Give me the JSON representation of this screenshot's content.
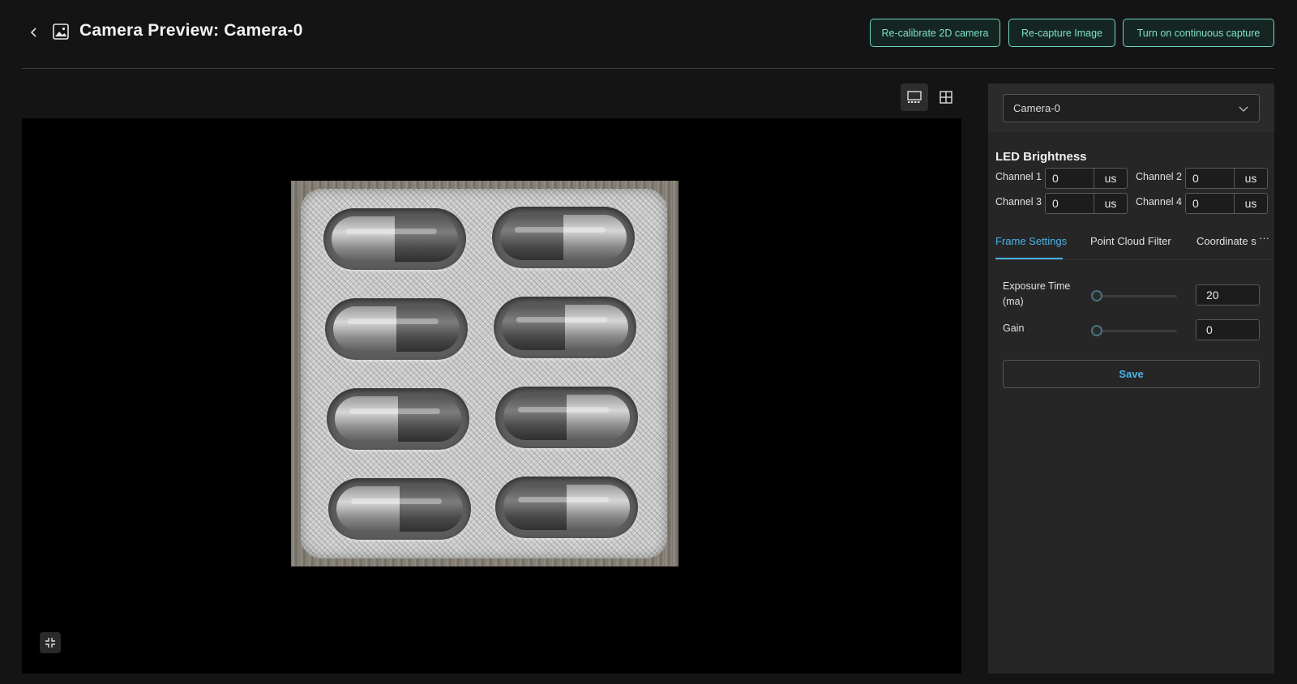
{
  "header": {
    "title": "Camera Preview: Camera-0",
    "buttons": {
      "recalibrate": "Re-calibrate 2D camera",
      "recapture": "Re-capture Image",
      "continuous": "Turn on continuous capture"
    }
  },
  "colors": {
    "accent_teal": "#7fe0cc",
    "accent_blue": "#4cb3e8",
    "background": "#141414",
    "panel": "#262626"
  },
  "icons": {
    "back": "chevron-left-icon",
    "title": "image-icon",
    "single_view": "single-view-icon",
    "grid_view": "grid-view-icon",
    "fit": "collapse-icon",
    "dropdown": "chevron-down-icon"
  },
  "panel": {
    "camera_select": "Camera-0",
    "led": {
      "title": "LED Brightness",
      "channels": [
        {
          "label": "Channel 1",
          "value": "0",
          "unit": "us"
        },
        {
          "label": "Channel 2",
          "value": "0",
          "unit": "us"
        },
        {
          "label": "Channel 3",
          "value": "0",
          "unit": "us"
        },
        {
          "label": "Channel 4",
          "value": "0",
          "unit": "us"
        }
      ]
    },
    "tabs": [
      {
        "label": "Frame Settings",
        "active": true
      },
      {
        "label": "Point Cloud Filter",
        "active": false
      },
      {
        "label": "Coordinate s",
        "active": false
      }
    ],
    "tab_more": "···",
    "frame_settings": {
      "exposure": {
        "label": "Exposure Time (ma)",
        "value": "20",
        "slider_fraction": 0
      },
      "gain": {
        "label": "Gain",
        "value": "0",
        "slider_fraction": 0
      }
    },
    "save_label": "Save"
  }
}
